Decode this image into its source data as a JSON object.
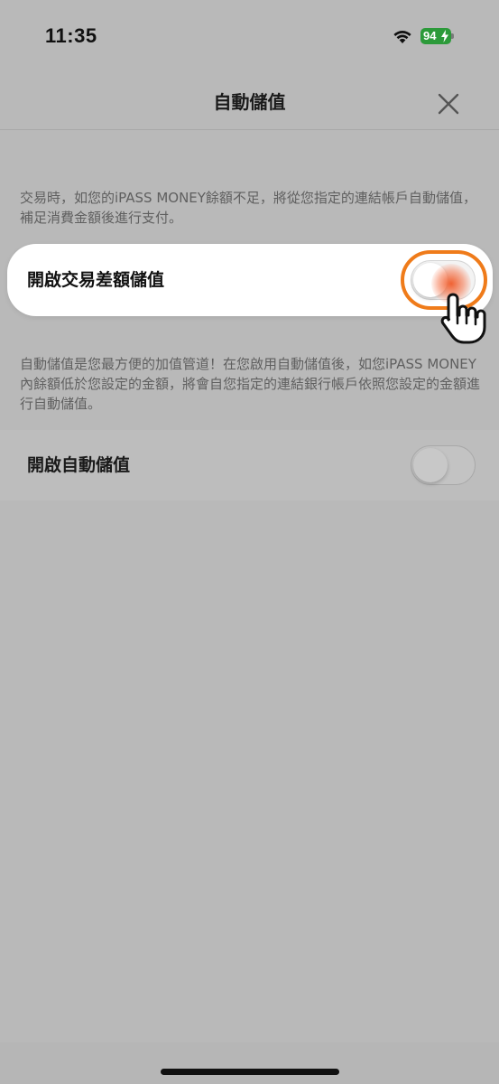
{
  "status_bar": {
    "time": "11:35",
    "battery": "94",
    "icons": [
      "wifi-icon",
      "battery-icon",
      "bolt-icon"
    ]
  },
  "nav": {
    "title": "自動儲值",
    "close_icon": "close-icon"
  },
  "description_top": "交易時，如您的iPASS MONEY餘額不足，將從您指定的連結帳戶自動儲值，補足消費金額後進行支付。",
  "difference_topup": {
    "label": "開啟交易差額儲值",
    "enabled": false
  },
  "description_auto": "自動儲值是您最方便的加值管道！在您啟用自動儲值後，如您iPASS MONEY內餘額低於您設定的金額，將會自您指定的連結銀行帳戶依照您設定的金額進行自動儲值。",
  "auto_topup": {
    "label": "開啟自動儲值",
    "enabled": false
  },
  "colors": {
    "overlay": "#b9b9b9",
    "focus_ring": "#ef7b1a",
    "tap": "#f05a28",
    "battery": "#2c9a3a"
  },
  "tutorial": {
    "pointer_icon": "hand-pointer-icon"
  }
}
